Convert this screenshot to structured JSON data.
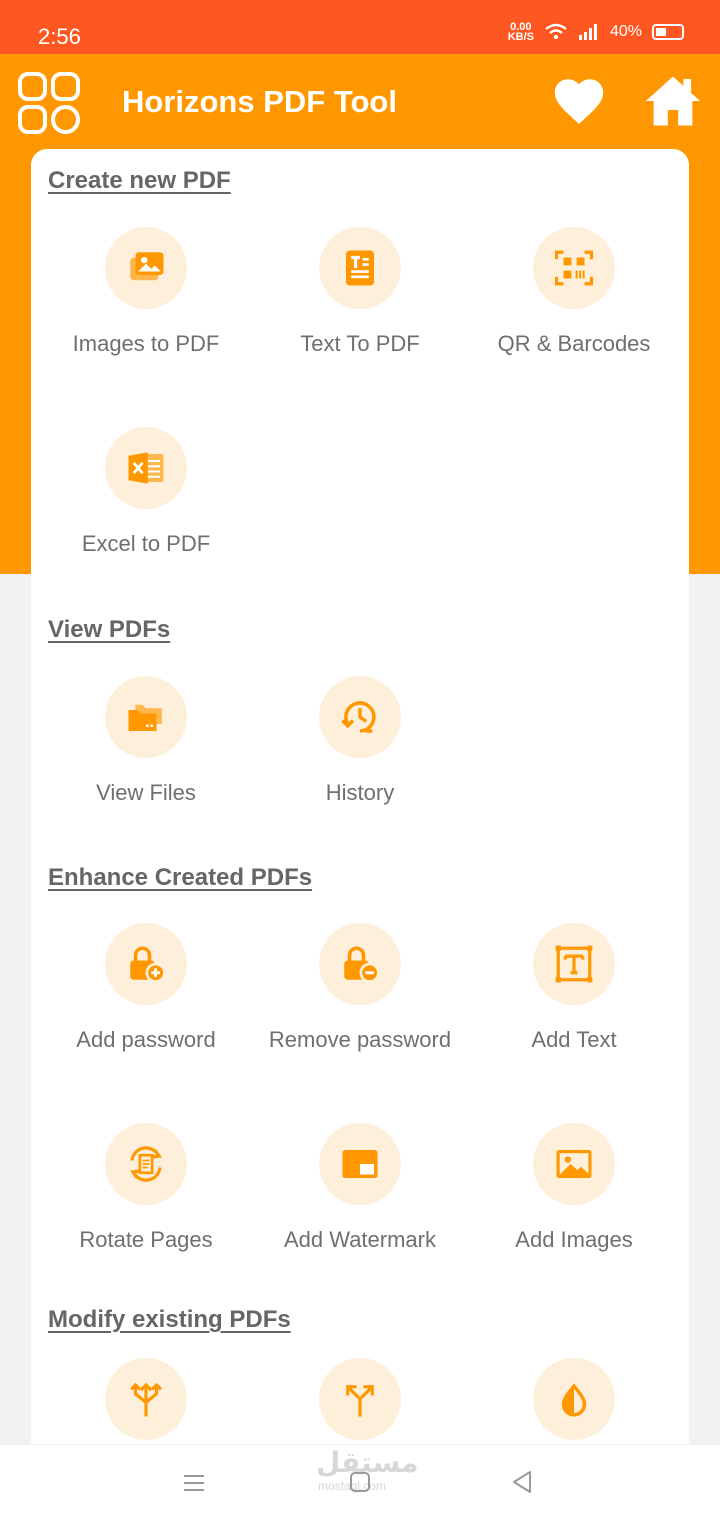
{
  "status": {
    "time": "2:56",
    "net_speed_value": "0.00",
    "net_speed_unit": "KB/S",
    "battery": "40%"
  },
  "header": {
    "title": "Horizons PDF Tool"
  },
  "sections": {
    "create": {
      "title": "Create new PDF",
      "tools": [
        "Images to PDF",
        "Text To PDF",
        "QR & Barcodes",
        "Excel to PDF"
      ]
    },
    "view": {
      "title": "View PDFs",
      "tools": [
        "View Files",
        "History"
      ]
    },
    "enhance": {
      "title": "Enhance Created PDFs",
      "tools": [
        "Add password",
        "Remove password",
        "Add Text",
        "Rotate Pages",
        "Add Watermark",
        "Add Images"
      ]
    },
    "modify": {
      "title": "Modify existing PDFs"
    }
  },
  "watermark": {
    "text": "مستقل",
    "sub": "mostaql.com"
  },
  "colors": {
    "status_bar": "#ff5722",
    "header": "#ff9800",
    "icon": "#ff9800",
    "icon_bg": "#fdefd9"
  }
}
